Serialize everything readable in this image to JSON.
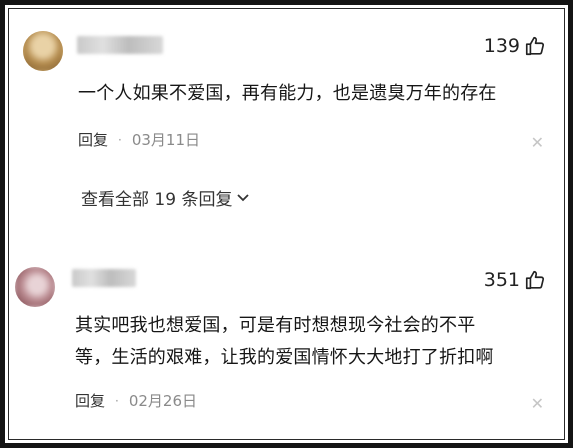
{
  "comments": [
    {
      "likes": "139",
      "text": "一个人如果不爱国，再有能力，也是遗臭万年的存在",
      "reply_label": "回复",
      "separator": "·",
      "date": "03月11日",
      "view_replies": "查看全部 19 条回复"
    },
    {
      "likes": "351",
      "text_line1": "其实吧我也想爱国，可是有时想想现今社会的不平",
      "text_line2": "等，生活的艰难，让我的爱国情怀大大地打了折扣啊",
      "reply_label": "回复",
      "separator": "·",
      "date": "02月26日"
    }
  ],
  "icons": [
    "thumbs-up-icon",
    "close-icon",
    "chevron-down-icon"
  ],
  "colors": {
    "text": "#161616",
    "muted": "#8a8a8a",
    "frame": "#141414"
  }
}
